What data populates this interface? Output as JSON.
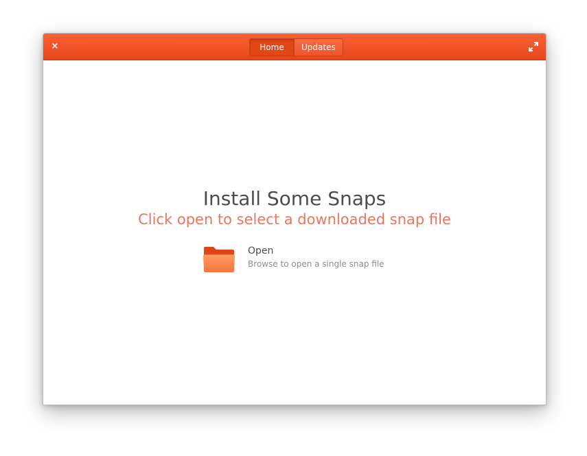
{
  "header": {
    "close_glyph": "×",
    "tabs": [
      {
        "label": "Home",
        "active": true
      },
      {
        "label": "Updates",
        "active": false
      }
    ],
    "colors": {
      "headerbar": "#e8461b",
      "accent": "#e8765d"
    }
  },
  "main": {
    "title": "Install Some Snaps",
    "subtitle": "Click open to select a downloaded snap file",
    "open_action": {
      "label": "Open",
      "description": "Browse to open a single snap file",
      "icon": "folder-icon"
    }
  }
}
